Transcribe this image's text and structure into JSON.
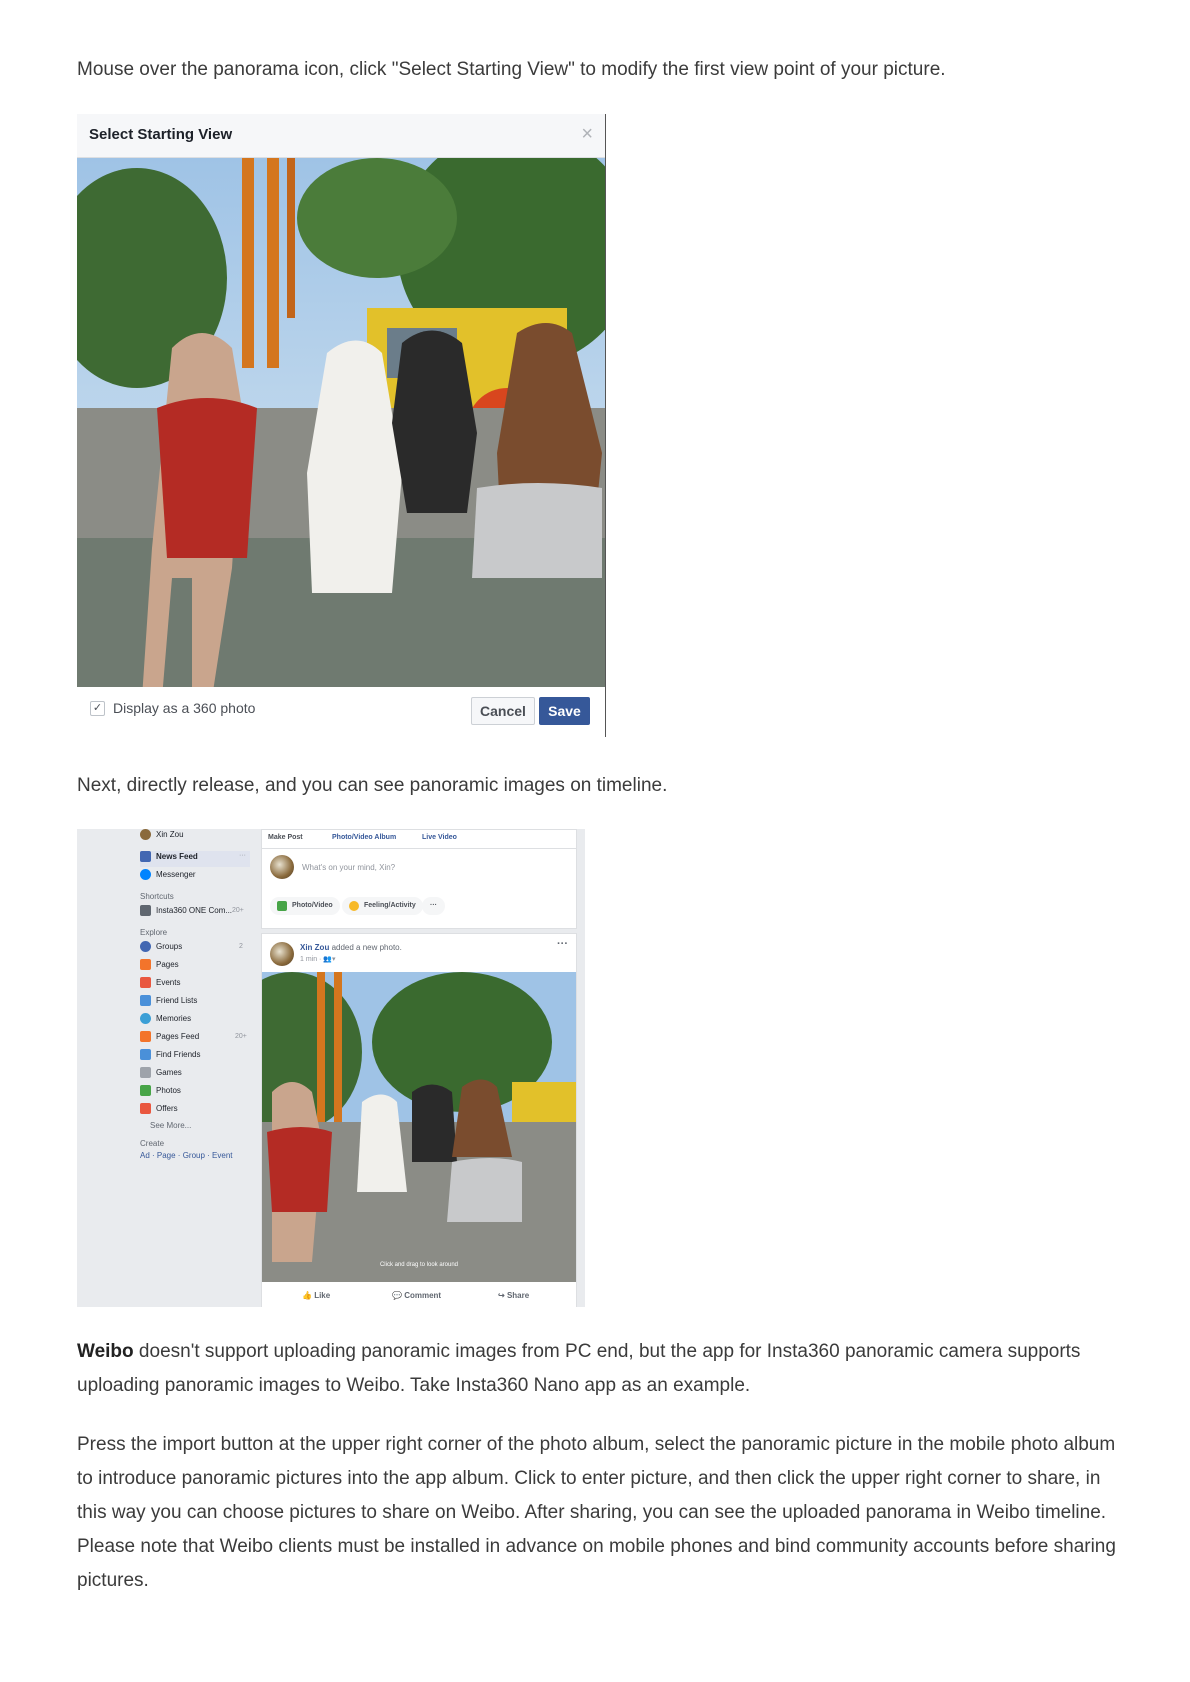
{
  "intro": "Mouse over the panorama icon, click \"Select Starting View\" to modify the first view point of your picture.",
  "dialog": {
    "title": "Select Starting View",
    "close": "×",
    "checkbox_checked": true,
    "checkbox_label": "Display as a 360 photo",
    "cancel_label": "Cancel",
    "save_label": "Save"
  },
  "after_dialog": "Next, directly release, and you can see panoramic images on timeline.",
  "facebook": {
    "user_name": "Xin Zou",
    "nav": [
      {
        "label": "News Feed",
        "color": "#4267b2"
      },
      {
        "label": "Messenger",
        "color": "#0084ff"
      }
    ],
    "nav_more": "···",
    "shortcuts_heading": "Shortcuts",
    "shortcut": {
      "label": "Insta360 ONE Com...",
      "count": "20+"
    },
    "explore_heading": "Explore",
    "explore": [
      {
        "label": "Groups",
        "count": "2",
        "color": "#4267b2"
      },
      {
        "label": "Pages",
        "count": "",
        "color": "#f3742b"
      },
      {
        "label": "Events",
        "count": "",
        "color": "#e9573f"
      },
      {
        "label": "Friend Lists",
        "count": "",
        "color": "#4a90d9"
      },
      {
        "label": "Memories",
        "count": "",
        "color": "#3b9fd6"
      },
      {
        "label": "Pages Feed",
        "count": "20+",
        "color": "#f3742b"
      },
      {
        "label": "Find Friends",
        "count": "",
        "color": "#4a90d9"
      },
      {
        "label": "Games",
        "count": "",
        "color": "#9ea3aa"
      },
      {
        "label": "Photos",
        "count": "",
        "color": "#47a447"
      },
      {
        "label": "Offers",
        "count": "",
        "color": "#e9573f"
      }
    ],
    "see_more": "See More...",
    "create_heading": "Create",
    "create_links": "Ad · Page · Group · Event",
    "composer": {
      "tab_make_post": "Make Post",
      "tab_album": "Photo/Video Album",
      "tab_live": "Live Video",
      "placeholder": "What's on your mind, Xin?",
      "btn_photo": "Photo/Video",
      "btn_feeling": "Feeling/Activity",
      "btn_more": "···"
    },
    "post": {
      "author": "Xin Zou",
      "action": "added a new photo.",
      "meta": "1 min · ",
      "more": "···",
      "drag_hint": "Click and drag to look around",
      "like": "Like",
      "comment": "Comment",
      "share": "Share"
    }
  },
  "weibo_bold": "Weibo",
  "weibo_text": " doesn't support uploading panoramic images from PC end, but the app for Insta360 panoramic camera supports uploading panoramic images to Weibo. Take Insta360 Nano app as an example.",
  "final_paragraph": "Press the import button at the upper right corner of the photo album, select the panoramic picture in the mobile photo album to introduce panoramic pictures into the app album. Click to enter picture, and then click the upper right corner to share, in this way you can choose pictures to share on Weibo. After sharing, you can see the uploaded panorama in Weibo timeline. Please note that Weibo clients must be installed in advance on mobile phones and bind community accounts before sharing pictures."
}
